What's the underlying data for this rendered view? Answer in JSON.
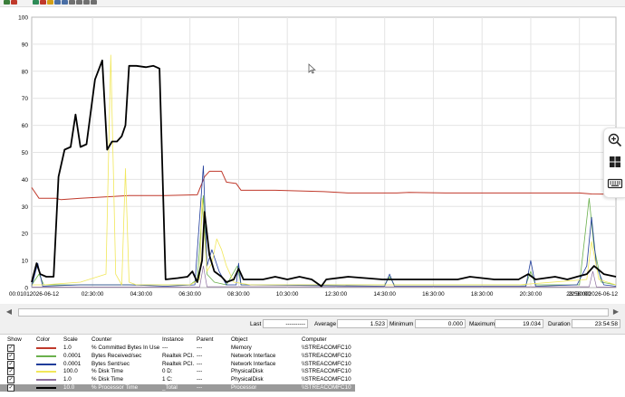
{
  "toolbar": {
    "icons": [
      {
        "name": "view-current-activity-icon",
        "color": "#3a7d3a"
      },
      {
        "name": "change-graph-type-icon",
        "color": "#c0392b"
      },
      {
        "name": "add-counter-icon",
        "color": "#2e8b57"
      },
      {
        "name": "delete-counter-icon",
        "color": "#c0392b"
      },
      {
        "name": "highlight-icon",
        "color": "#d4a017"
      },
      {
        "name": "copy-properties-icon",
        "color": "#4a6fa5"
      },
      {
        "name": "paste-counter-list-icon",
        "color": "#4a6fa5"
      },
      {
        "name": "properties-icon",
        "color": "#707070"
      },
      {
        "name": "zoom-icon",
        "color": "#707070"
      },
      {
        "name": "freeze-display-icon",
        "color": "#707070"
      },
      {
        "name": "update-data-icon",
        "color": "#707070"
      }
    ]
  },
  "chart_data": {
    "type": "line",
    "title": "",
    "xlabel": "",
    "ylabel": "",
    "ylim": [
      0,
      100
    ],
    "yticks": [
      "0",
      "10",
      "20",
      "30",
      "40",
      "50",
      "60",
      "70",
      "80",
      "90",
      "100"
    ],
    "xlim": [
      "00:00",
      "24:00"
    ],
    "xtick_hours": [
      0,
      2.5,
      4.5,
      6.5,
      8.5,
      10.5,
      12.5,
      14.5,
      16.5,
      18.5,
      20.5,
      22.5,
      24
    ],
    "xticks": [
      "00:01012026-06-12",
      "02:30:00",
      "04:30:00",
      "06:30:00",
      "08:30:00",
      "10:30:00",
      "12:30:00",
      "14:30:00",
      "16:30:00",
      "18:30:00",
      "20:30:00",
      "22:30:00",
      "23:56:002026-06-12"
    ],
    "grid": true,
    "series": [
      {
        "name": "% Committed Bytes In Use",
        "color": "#c0392b",
        "width": 1,
        "points": [
          [
            0,
            37
          ],
          [
            0.3,
            33
          ],
          [
            1,
            33
          ],
          [
            1.2,
            32.5
          ],
          [
            2,
            33
          ],
          [
            3,
            33.5
          ],
          [
            4,
            34
          ],
          [
            5.5,
            34
          ],
          [
            6.8,
            34.3
          ],
          [
            7.1,
            41
          ],
          [
            7.3,
            43
          ],
          [
            7.8,
            43
          ],
          [
            8,
            39
          ],
          [
            8.4,
            38.5
          ],
          [
            8.6,
            36
          ],
          [
            10,
            36
          ],
          [
            12,
            35.5
          ],
          [
            13,
            35
          ],
          [
            15,
            35
          ],
          [
            15.5,
            35.2
          ],
          [
            17,
            35
          ],
          [
            19,
            35
          ],
          [
            21,
            35
          ],
          [
            22.5,
            35
          ],
          [
            23,
            34.6
          ],
          [
            24,
            34.5
          ]
        ]
      },
      {
        "name": "Bytes Received/sec",
        "color": "#6ab04c",
        "width": 0.8,
        "points": [
          [
            0,
            1
          ],
          [
            0.3,
            5
          ],
          [
            0.5,
            1
          ],
          [
            2,
            1
          ],
          [
            3.5,
            1
          ],
          [
            5,
            1
          ],
          [
            6.5,
            1
          ],
          [
            6.8,
            3
          ],
          [
            7.05,
            34
          ],
          [
            7.2,
            5
          ],
          [
            7.5,
            2
          ],
          [
            8,
            1
          ],
          [
            8.45,
            8
          ],
          [
            8.6,
            1
          ],
          [
            10,
            1
          ],
          [
            14.5,
            1
          ],
          [
            14.7,
            4
          ],
          [
            14.9,
            1
          ],
          [
            20.3,
            1
          ],
          [
            20.5,
            6
          ],
          [
            20.7,
            1
          ],
          [
            22.5,
            1
          ],
          [
            22.9,
            33
          ],
          [
            23.1,
            15
          ],
          [
            23.4,
            2
          ],
          [
            24,
            1
          ]
        ]
      },
      {
        "name": "Bytes Sent/sec",
        "color": "#1f3c9a",
        "width": 0.8,
        "points": [
          [
            0,
            0.5
          ],
          [
            0.25,
            9
          ],
          [
            0.45,
            0.5
          ],
          [
            2,
            1
          ],
          [
            4,
            1
          ],
          [
            5.5,
            0.5
          ],
          [
            6.7,
            1
          ],
          [
            7.05,
            45
          ],
          [
            7.2,
            8
          ],
          [
            7.4,
            14
          ],
          [
            7.7,
            6
          ],
          [
            8,
            1
          ],
          [
            8.4,
            1
          ],
          [
            8.5,
            9
          ],
          [
            8.6,
            1
          ],
          [
            14.5,
            0.5
          ],
          [
            14.7,
            5
          ],
          [
            14.9,
            0.5
          ],
          [
            20.3,
            0.5
          ],
          [
            20.5,
            10
          ],
          [
            20.7,
            0.5
          ],
          [
            22.4,
            1
          ],
          [
            22.8,
            8
          ],
          [
            23.0,
            26
          ],
          [
            23.2,
            8
          ],
          [
            23.5,
            1
          ],
          [
            24,
            0.5
          ]
        ]
      },
      {
        "name": "% Disk Time",
        "color": "#f1e75a",
        "width": 0.8,
        "points": [
          [
            0,
            1
          ],
          [
            0.5,
            1
          ],
          [
            2,
            2
          ],
          [
            3.05,
            5
          ],
          [
            3.25,
            86
          ],
          [
            3.45,
            5
          ],
          [
            3.7,
            1
          ],
          [
            3.85,
            44
          ],
          [
            4.0,
            2
          ],
          [
            4.3,
            1
          ],
          [
            6.5,
            1
          ],
          [
            6.9,
            3
          ],
          [
            7.0,
            33
          ],
          [
            7.2,
            6
          ],
          [
            7.4,
            9
          ],
          [
            7.6,
            18
          ],
          [
            7.8,
            14
          ],
          [
            8,
            8
          ],
          [
            8.3,
            2
          ],
          [
            9,
            1
          ],
          [
            15,
            1
          ],
          [
            20,
            1
          ],
          [
            22.8,
            3
          ],
          [
            23.0,
            17
          ],
          [
            23.3,
            3
          ],
          [
            24,
            1
          ]
        ]
      },
      {
        "name": "% Disk Time ",
        "color": "#8d6e9e",
        "width": 0.7,
        "points": [
          [
            0,
            0.2
          ],
          [
            6.9,
            0.2
          ],
          [
            7.05,
            8
          ],
          [
            7.2,
            0.3
          ],
          [
            22.9,
            0.3
          ],
          [
            23.05,
            6
          ],
          [
            23.2,
            0.2
          ],
          [
            24,
            0.2
          ]
        ]
      },
      {
        "name": "% Processor Time",
        "color": "#000000",
        "width": 1.8,
        "points": [
          [
            0,
            2
          ],
          [
            0.2,
            9
          ],
          [
            0.35,
            5
          ],
          [
            0.6,
            4
          ],
          [
            0.9,
            4
          ],
          [
            1.1,
            41
          ],
          [
            1.35,
            51
          ],
          [
            1.6,
            52
          ],
          [
            1.8,
            64
          ],
          [
            2.0,
            52
          ],
          [
            2.25,
            53
          ],
          [
            2.6,
            77
          ],
          [
            2.9,
            84
          ],
          [
            3.1,
            51
          ],
          [
            3.3,
            54
          ],
          [
            3.5,
            54
          ],
          [
            3.7,
            56
          ],
          [
            3.85,
            60
          ],
          [
            4.0,
            82
          ],
          [
            4.3,
            82
          ],
          [
            4.7,
            81.5
          ],
          [
            5.0,
            82
          ],
          [
            5.25,
            81
          ],
          [
            5.5,
            3
          ],
          [
            6.0,
            3.5
          ],
          [
            6.4,
            4
          ],
          [
            6.6,
            6
          ],
          [
            6.8,
            2
          ],
          [
            7.0,
            10
          ],
          [
            7.1,
            28
          ],
          [
            7.3,
            12
          ],
          [
            7.5,
            6
          ],
          [
            7.8,
            4
          ],
          [
            8.0,
            2
          ],
          [
            8.3,
            3
          ],
          [
            8.5,
            7
          ],
          [
            8.7,
            3
          ],
          [
            9.5,
            3
          ],
          [
            10,
            4
          ],
          [
            10.5,
            3
          ],
          [
            11,
            4
          ],
          [
            11.5,
            3
          ],
          [
            11.9,
            0.5
          ],
          [
            12.1,
            3
          ],
          [
            13,
            4
          ],
          [
            14.4,
            3
          ],
          [
            14.7,
            3
          ],
          [
            15.5,
            3
          ],
          [
            16,
            3
          ],
          [
            17.5,
            3
          ],
          [
            18,
            4
          ],
          [
            19,
            3
          ],
          [
            20,
            3
          ],
          [
            20.4,
            5
          ],
          [
            20.7,
            3
          ],
          [
            21.5,
            4
          ],
          [
            22.0,
            3
          ],
          [
            22.4,
            4
          ],
          [
            22.8,
            5
          ],
          [
            23.1,
            8
          ],
          [
            23.5,
            5
          ],
          [
            24,
            4
          ]
        ]
      }
    ]
  },
  "stats": {
    "last_label": "Last",
    "last_value": "----------",
    "average_label": "Average",
    "average_value": "1.523",
    "minimum_label": "Minimum",
    "minimum_value": "0.000",
    "maximum_label": "Maximum",
    "maximum_value": "19.034",
    "duration_label": "Duration",
    "duration_value": "23:54:58"
  },
  "legend": {
    "headers": {
      "show": "Show",
      "color": "Color",
      "scale": "Scale",
      "counter": "Counter",
      "instance": "Instance",
      "parent": "Parent",
      "object": "Object",
      "computer": "Computer"
    },
    "rows": [
      {
        "color": "#c0392b",
        "scale": "1.0",
        "counter": "% Committed Bytes In Use",
        "instance": "---",
        "parent": "---",
        "object": "Memory",
        "computer": "\\\\STREACOMFC10",
        "selected": false
      },
      {
        "color": "#6ab04c",
        "scale": "0.0001",
        "counter": "Bytes Received/sec",
        "instance": "Realtek PCI...",
        "parent": "---",
        "object": "Network Interface",
        "computer": "\\\\STREACOMFC10",
        "selected": false
      },
      {
        "color": "#1f3c9a",
        "scale": "0.0001",
        "counter": "Bytes Sent/sec",
        "instance": "Realtek PCI...",
        "parent": "---",
        "object": "Network Interface",
        "computer": "\\\\STREACOMFC10",
        "selected": false
      },
      {
        "color": "#f1e75a",
        "scale": "100.0",
        "counter": "% Disk Time",
        "instance": "0 D:",
        "parent": "---",
        "object": "PhysicalDisk",
        "computer": "\\\\STREACOMFC10",
        "selected": false
      },
      {
        "color": "#8d6e9e",
        "scale": "1.0",
        "counter": "% Disk Time",
        "instance": "1 C:",
        "parent": "---",
        "object": "PhysicalDisk",
        "computer": "\\\\STREACOMFC10",
        "selected": false
      },
      {
        "color": "#000000",
        "scale": "10.0",
        "counter": "% Processor Time",
        "instance": "_Total",
        "parent": "---",
        "object": "Processor",
        "computer": "\\\\STREACOMFC10",
        "selected": true
      }
    ]
  }
}
